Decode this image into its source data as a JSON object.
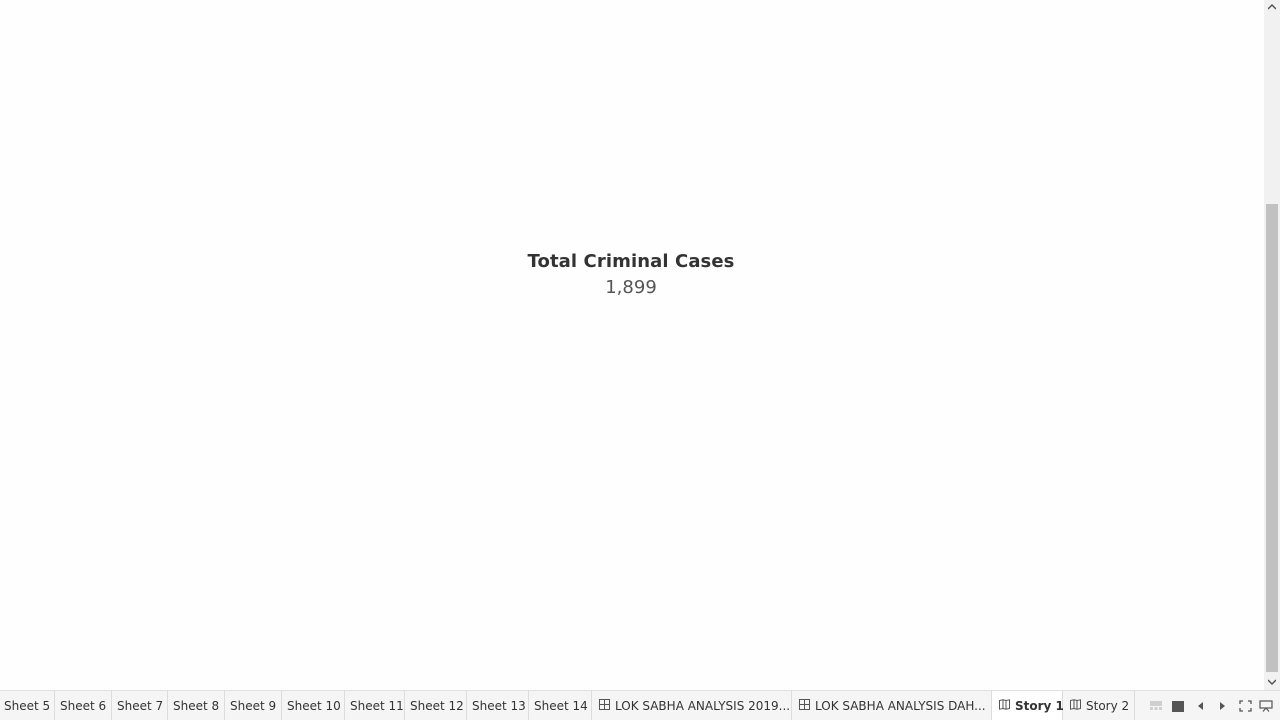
{
  "kpi": {
    "title": "Total Criminal Cases",
    "value": "1,899"
  },
  "tabs": [
    {
      "label": "Sheet 5",
      "kind": "sheet"
    },
    {
      "label": "Sheet 6",
      "kind": "sheet"
    },
    {
      "label": "Sheet 7",
      "kind": "sheet"
    },
    {
      "label": "Sheet 8",
      "kind": "sheet"
    },
    {
      "label": "Sheet 9",
      "kind": "sheet"
    },
    {
      "label": "Sheet 10",
      "kind": "sheet"
    },
    {
      "label": "Sheet 11",
      "kind": "sheet"
    },
    {
      "label": "Sheet 12",
      "kind": "sheet"
    },
    {
      "label": "Sheet 13",
      "kind": "sheet"
    },
    {
      "label": "Sheet 14",
      "kind": "sheet"
    },
    {
      "label": "LOK SABHA ANALYSIS 2019...",
      "kind": "dashboard",
      "icon": "dashboard-icon"
    },
    {
      "label": "LOK SABHA ANALYSIS DAH...",
      "kind": "dashboard",
      "icon": "dashboard-icon"
    },
    {
      "label": "Story 1",
      "kind": "story",
      "icon": "story-icon",
      "active": true
    },
    {
      "label": "Story 2",
      "kind": "story",
      "icon": "story-icon"
    }
  ],
  "controls": [
    {
      "name": "filmstrip-view-icon"
    },
    {
      "name": "single-view-icon"
    },
    {
      "name": "previous-sheet-icon"
    },
    {
      "name": "next-sheet-icon"
    },
    {
      "name": "fullscreen-icon"
    },
    {
      "name": "presentation-mode-icon"
    }
  ],
  "colors": {
    "background": "#fefefe",
    "tabbar": "#f5f5f5",
    "text": "#333333",
    "scroll_thumb": "#c1c1c1"
  }
}
